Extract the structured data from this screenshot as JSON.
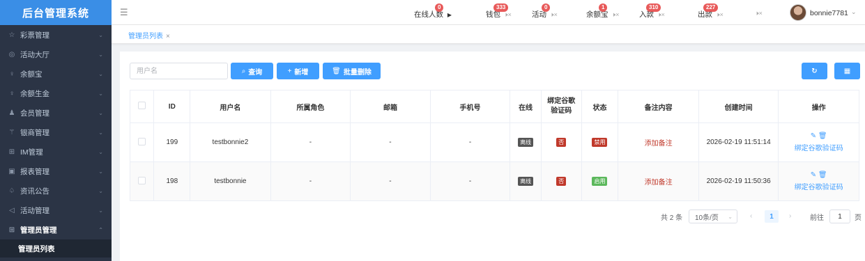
{
  "sidebar": {
    "logo": "后台管理系统",
    "items": [
      {
        "icon": "☆",
        "label": "彩票管理"
      },
      {
        "icon": "◎",
        "label": "活动大厅"
      },
      {
        "icon": "♀",
        "label": "余额宝"
      },
      {
        "icon": "♀",
        "label": "余额生金"
      },
      {
        "icon": "♟",
        "label": "会员管理"
      },
      {
        "icon": "⚚",
        "label": "银商管理"
      },
      {
        "icon": "⊞",
        "label": "IM管理"
      },
      {
        "icon": "▣",
        "label": "报表管理"
      },
      {
        "icon": "♤",
        "label": "资讯公告"
      },
      {
        "icon": "◁",
        "label": "活动管理"
      },
      {
        "icon": "⊞",
        "label": "管理员管理"
      }
    ],
    "expand_chevron": "⌄",
    "collapse_chevron": "⌃",
    "sub_item": "管理员列表"
  },
  "topbar": {
    "menu_icon": "☰",
    "online": {
      "label": "在线人数",
      "badge": "0",
      "arrow": "▶"
    },
    "wallet": {
      "label": "钱包",
      "badge": "333"
    },
    "activity": {
      "label": "活动",
      "badge": "0"
    },
    "yuebao": {
      "label": "余额宝",
      "badge": "1"
    },
    "deposit": {
      "label": "入款",
      "badge": "310"
    },
    "withdraw": {
      "label": "出款",
      "badge": "227"
    },
    "speaker": "🕨×",
    "username": "bonnie7781",
    "user_chevron": "⌄"
  },
  "tabs": [
    {
      "label": "管理员列表",
      "close": "×"
    }
  ],
  "toolbar": {
    "search_placeholder": "用户名",
    "query_icon": "⌕",
    "query_label": "查询",
    "add_icon": "+",
    "add_label": "新增",
    "delete_icon": "🗑",
    "delete_label": "批量删除",
    "refresh_icon": "↻",
    "columns_icon": "▦"
  },
  "table": {
    "headers": [
      "ID",
      "用户名",
      "所属角色",
      "邮箱",
      "手机号",
      "在线",
      "绑定谷歌验证码",
      "状态",
      "备注内容",
      "创建时间",
      "操作"
    ],
    "rows": [
      {
        "id": "199",
        "username": "testbonnie2",
        "role": "-",
        "email": "-",
        "phone": "-",
        "online": "离线",
        "google": "否",
        "status": "禁用",
        "remark": "添加备注",
        "created": "2026-02-19 11:51:14",
        "edit_icon": "✎",
        "delete_icon": "🗑",
        "op_link": "绑定谷歌验证码"
      },
      {
        "id": "198",
        "username": "testbonnie",
        "role": "-",
        "email": "-",
        "phone": "-",
        "online": "离线",
        "google": "否",
        "status": "启用",
        "remark": "添加备注",
        "created": "2026-02-19 11:50:36",
        "edit_icon": "✎",
        "delete_icon": "🗑",
        "op_link": "绑定谷歌验证码"
      }
    ]
  },
  "pagination": {
    "total": "共 2 条",
    "page_size": "10条/页",
    "size_chevron": "⌄",
    "prev": "‹",
    "next": "›",
    "current": "1",
    "goto_label": "前往",
    "goto_value": "1",
    "page_unit": "页"
  },
  "colors": {
    "primary": "#409eff",
    "sidebar_bg": "#2b3445",
    "logo_bg": "#3a8ee6",
    "danger": "#c0392b",
    "success": "#5cb85c"
  }
}
